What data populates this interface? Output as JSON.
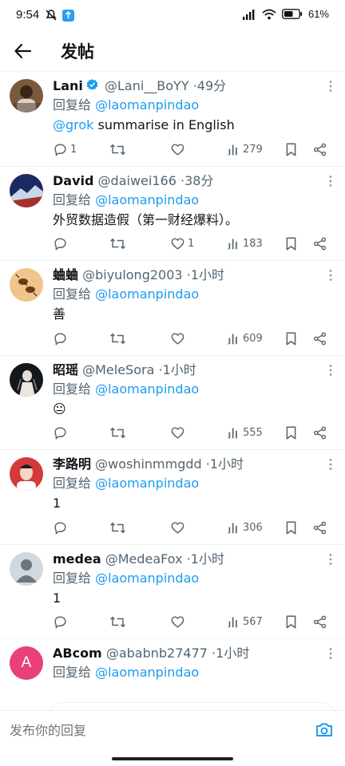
{
  "status": {
    "time": "9:54",
    "battery": "61%"
  },
  "header": {
    "title": "发帖"
  },
  "reply_prefix": "回复给",
  "tweets": [
    {
      "name": "Lani",
      "verified": true,
      "handle": "@Lani__BoYY",
      "time": "49分",
      "reply_to": "@laomanpindao",
      "body_mention": "@grok",
      "body": " summarise in English",
      "replies": "1",
      "retweets": "",
      "likes": "",
      "views": "279",
      "avatar_icon": "photo-avatar"
    },
    {
      "name": "David",
      "verified": false,
      "handle": "@daiwei166",
      "time": "38分",
      "reply_to": "@laomanpindao",
      "body_mention": "",
      "body": "外贸数据造假（第一财经爆料）。",
      "replies": "",
      "retweets": "",
      "likes": "1",
      "views": "183",
      "avatar_icon": "photo-avatar"
    },
    {
      "name": "蛐蛐",
      "verified": false,
      "handle": "@biyulong2003",
      "time": "1小时",
      "reply_to": "@laomanpindao",
      "body_mention": "",
      "body": "善",
      "replies": "",
      "retweets": "",
      "likes": "",
      "views": "609",
      "avatar_icon": "photo-avatar"
    },
    {
      "name": "昭瑶",
      "verified": false,
      "handle": "@MeleSora",
      "time": "1小时",
      "reply_to": "@laomanpindao",
      "body_mention": "",
      "body": "😐",
      "replies": "",
      "retweets": "",
      "likes": "",
      "views": "555",
      "avatar_icon": "photo-avatar"
    },
    {
      "name": "李路明",
      "verified": false,
      "handle": "@woshinmmgdd",
      "time": "1小时",
      "reply_to": "@laomanpindao",
      "body_mention": "",
      "body": "1",
      "replies": "",
      "retweets": "",
      "likes": "",
      "views": "306",
      "avatar_icon": "photo-avatar"
    },
    {
      "name": "medea",
      "verified": false,
      "handle": "@MedeaFox",
      "time": "1小时",
      "reply_to": "@laomanpindao",
      "body_mention": "",
      "body": "1",
      "replies": "",
      "retweets": "",
      "likes": "",
      "views": "567",
      "avatar_icon": "default-avatar"
    },
    {
      "name": "ABcom",
      "verified": false,
      "handle": "@ababnb27477",
      "time": "1小时",
      "reply_to": "@laomanpindao",
      "body_mention": "",
      "body": "",
      "replies": "",
      "retweets": "",
      "likes": "",
      "views": "",
      "avatar_icon": "letter-avatar",
      "avatar_letter": "A"
    }
  ],
  "reply_bar": {
    "placeholder": "发布你的回复"
  },
  "colors": {
    "accent": "#1d9bf0",
    "text": "#0f1419",
    "muted": "#536471",
    "divider": "#eff3f4",
    "letter_avatar": "#e8417a"
  }
}
